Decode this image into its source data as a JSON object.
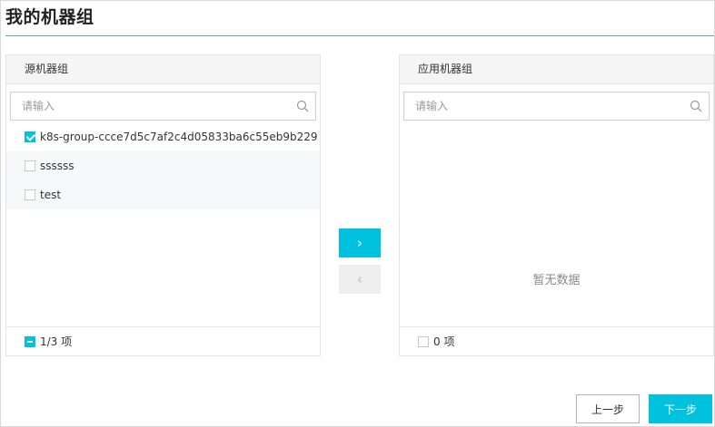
{
  "page": {
    "title": "我的机器组"
  },
  "source_panel": {
    "header": "源机器组",
    "search_placeholder": "请输入",
    "items": [
      {
        "label": "k8s-group-ccce7d5c7af2c4d05833ba6c55eb9b229",
        "checked": true
      },
      {
        "label": "ssssss",
        "checked": false
      },
      {
        "label": "test",
        "checked": false
      }
    ],
    "footer_count": "1/3 项"
  },
  "target_panel": {
    "header": "应用机器组",
    "search_placeholder": "请输入",
    "empty_text": "暂无数据",
    "footer_count": "0 项"
  },
  "transfer": {
    "to_right_glyph": "›",
    "to_left_glyph": "‹"
  },
  "footer": {
    "prev_label": "上一步",
    "next_label": "下一步"
  },
  "colors": {
    "accent": "#00c1de",
    "title_rule": "#5aa5c8"
  },
  "icons": {
    "search": "search-icon",
    "to_right": "chevron-right-icon",
    "to_left": "chevron-left-icon"
  }
}
